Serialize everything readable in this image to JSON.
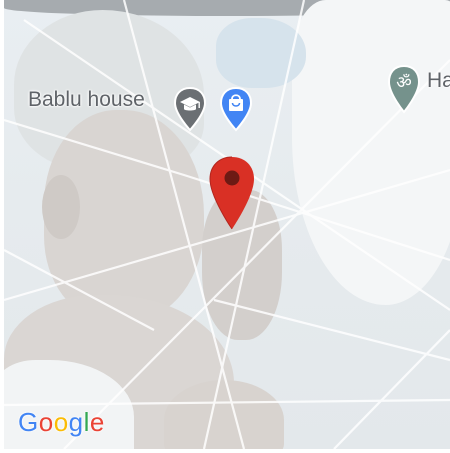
{
  "map": {
    "places": [
      {
        "label": "Bablu house",
        "icon": "school-icon",
        "color": "#6b6f73"
      },
      {
        "label": "",
        "icon": "shopping-bag-icon",
        "color": "#4285f4"
      },
      {
        "label": "Ha",
        "icon": "om-temple-icon",
        "color": "#75928c"
      }
    ],
    "selected_pin": {
      "icon": "red-location-pin-icon",
      "color": "#d93025"
    }
  },
  "logo": {
    "text": "Google",
    "letters": [
      {
        "char": "G",
        "color": "#4285f4"
      },
      {
        "char": "o",
        "color": "#ea4335"
      },
      {
        "char": "o",
        "color": "#fbbc05"
      },
      {
        "char": "g",
        "color": "#4285f4"
      },
      {
        "char": "l",
        "color": "#34a853"
      },
      {
        "char": "e",
        "color": "#ea4335"
      }
    ]
  }
}
